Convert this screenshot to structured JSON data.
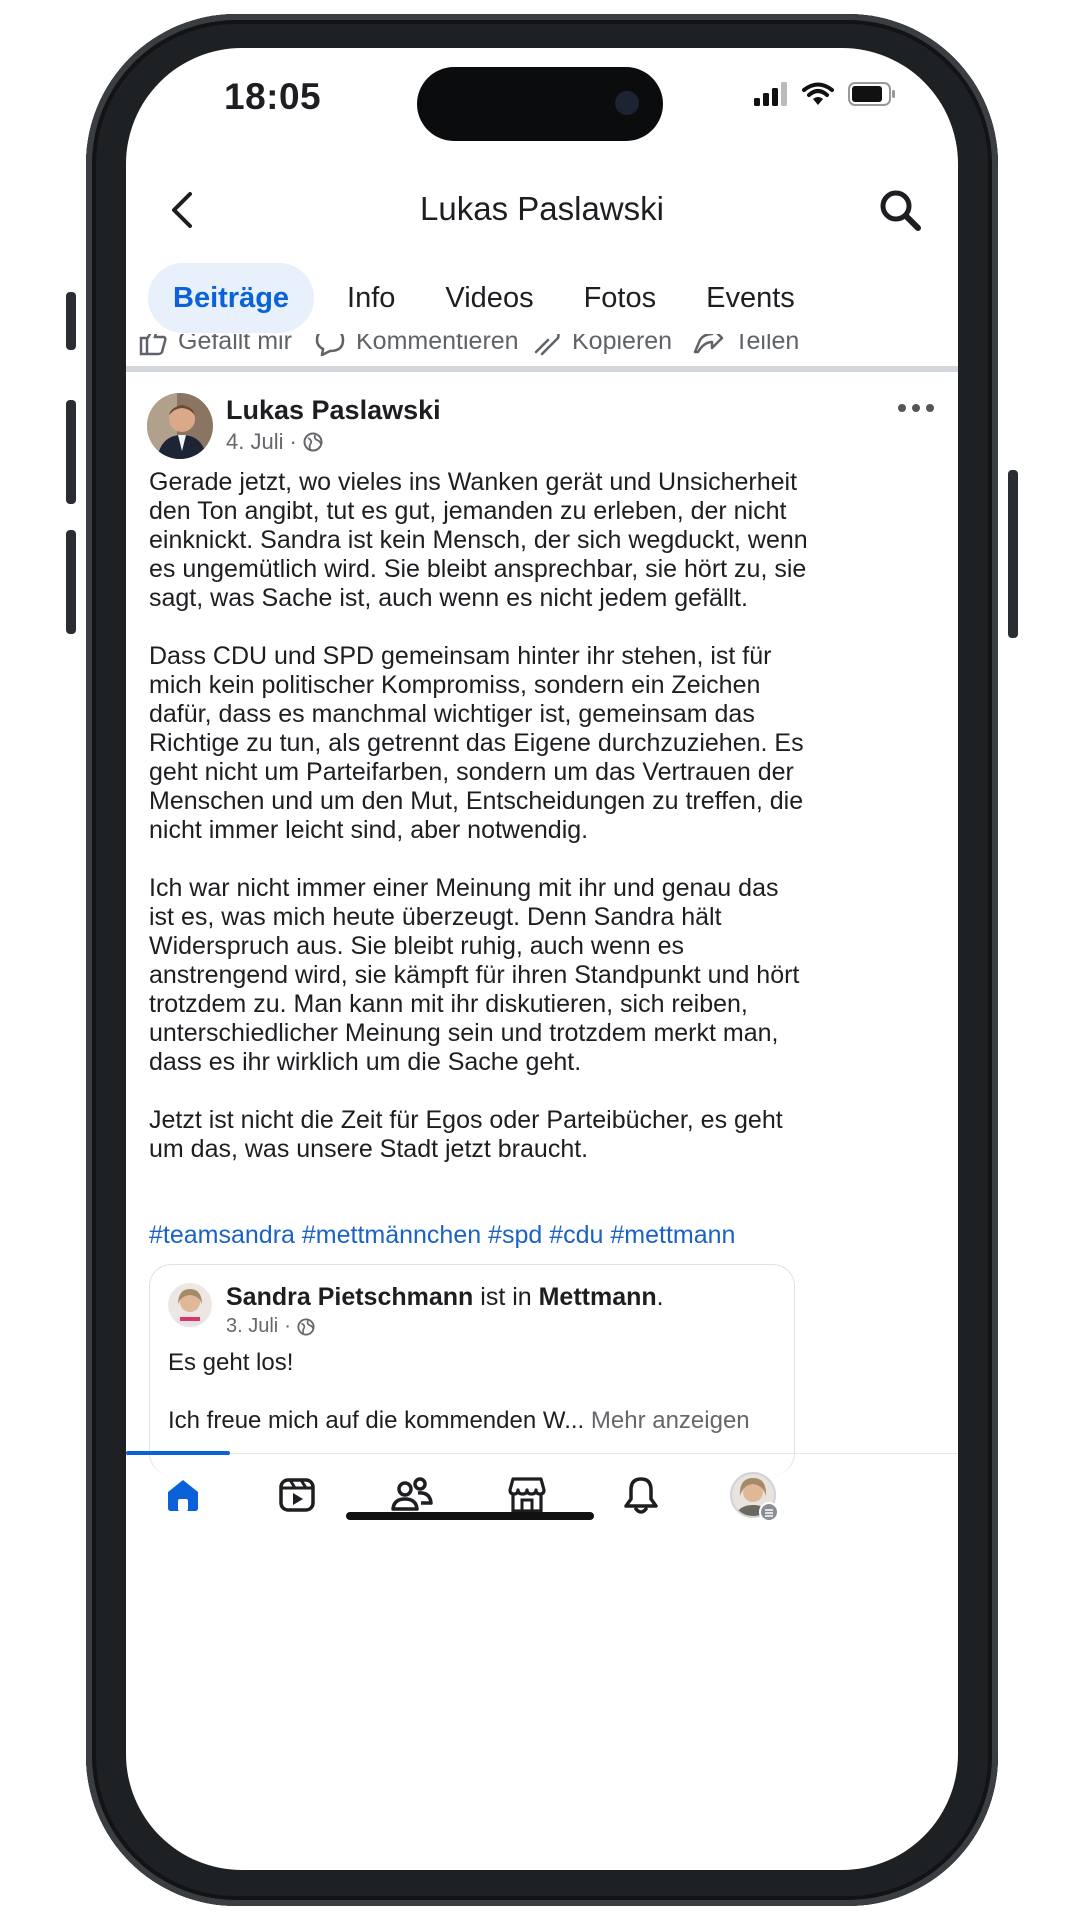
{
  "status_bar": {
    "time": "18:05"
  },
  "header": {
    "title": "Lukas Paslawski"
  },
  "tabs": [
    {
      "label": "Beiträge",
      "active": true
    },
    {
      "label": "Info"
    },
    {
      "label": "Videos"
    },
    {
      "label": "Fotos"
    },
    {
      "label": "Events"
    }
  ],
  "action_bar": {
    "like": "Gefällt mir",
    "comment": "Kommentieren",
    "copy": "Kopieren",
    "share": "Teilen"
  },
  "post": {
    "author": "Lukas Paslawski",
    "date": "4. Juli",
    "separator": "·",
    "paragraphs": [
      "Gerade jetzt, wo vieles ins Wanken gerät und Unsicherheit den Ton angibt, tut es gut, jemanden zu erleben, der nicht einknickt. Sandra ist kein Mensch, der sich wegduckt, wenn es ungemütlich wird. Sie bleibt ansprechbar, sie hört zu, sie sagt, was Sache ist, auch wenn es nicht jedem gefällt.",
      "Dass CDU und SPD gemeinsam hinter ihr stehen, ist für mich kein politischer Kompromiss, sondern ein Zeichen dafür, dass es manchmal wichtiger ist, gemeinsam das Richtige zu tun, als getrennt das Eigene durchzuziehen. Es geht nicht um Parteifarben, sondern um das Vertrauen der Menschen und um den Mut, Entscheidungen zu treffen, die nicht immer leicht sind, aber notwendig.",
      "Ich war nicht immer einer Meinung mit ihr und genau das ist es, was mich heute überzeugt. Denn Sandra hält Widerspruch aus. Sie bleibt ruhig, auch wenn es anstrengend wird, sie kämpft für ihren Standpunkt und hört trotzdem zu. Man kann mit ihr diskutieren, sich reiben, unterschiedlicher Meinung sein und trotzdem merkt man, dass es ihr wirklich um die Sache geht.",
      "Jetzt ist nicht die Zeit für Egos oder Parteibücher, es geht um das, was unsere Stadt jetzt braucht."
    ],
    "hashtags": "#teamsandra #mettmännchen #spd #cdu #mettmann"
  },
  "shared_post": {
    "author": "Sandra Pietschmann",
    "connector": " ist in ",
    "location": "Mettmann",
    "location_suffix": ".",
    "date": "3. Juli",
    "separator": "·",
    "line1": "Es geht los!",
    "line2": "Ich freue mich auf die kommenden W...",
    "more_label": "Mehr anzeigen"
  },
  "colors": {
    "accent": "#0b62d8",
    "hashtag": "#1a63c5",
    "tab_active_bg": "#e7f0fb",
    "muted": "#65676b"
  },
  "bottom_nav": {
    "items": [
      "home-icon",
      "video-icon",
      "friends-icon",
      "marketplace-icon",
      "bell-icon",
      "profile-avatar"
    ],
    "active": "home-icon"
  }
}
